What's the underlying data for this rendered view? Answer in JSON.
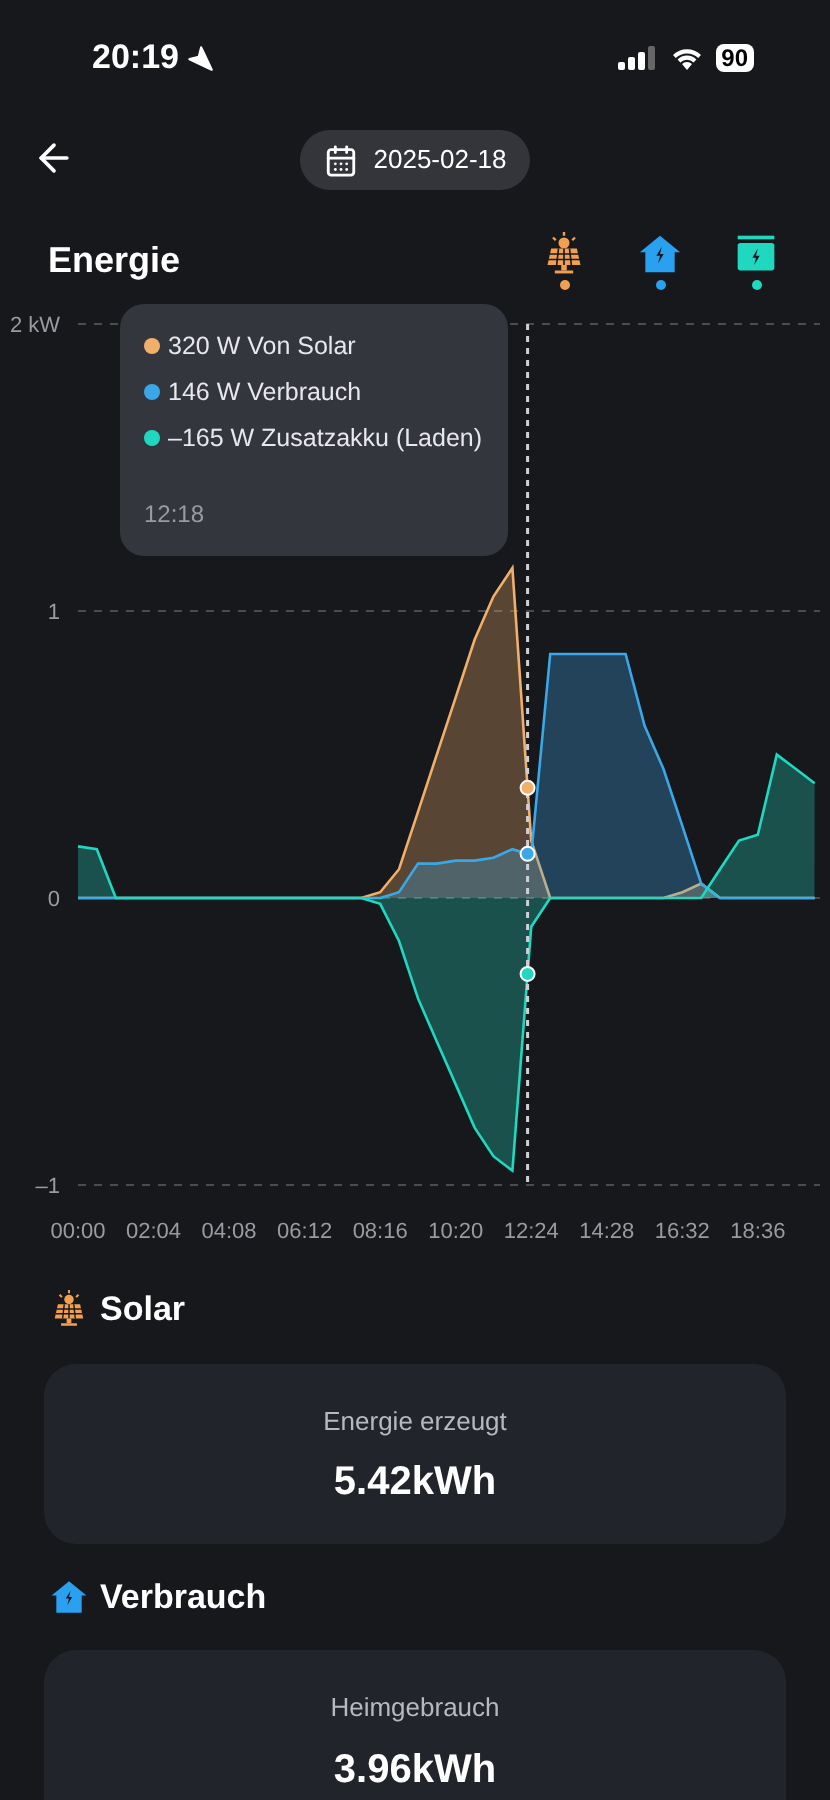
{
  "status_bar": {
    "time": "20:19",
    "battery": "90"
  },
  "header": {
    "date": "2025-02-18"
  },
  "section_title": "Energie",
  "legend": [
    {
      "kind": "solar",
      "color": "#f0a050",
      "selected": true
    },
    {
      "kind": "home",
      "color": "#2aa0f0",
      "selected": true
    },
    {
      "kind": "battery",
      "color": "#20d8c0",
      "selected": true
    }
  ],
  "chart": {
    "tooltip": {
      "time": "12:18",
      "values": [
        "320 W",
        "146 W",
        "–165 W"
      ]
    },
    "chart_data": {
      "type": "area",
      "xlim": [
        0,
        1218
      ],
      "ylim": [
        -1,
        2
      ],
      "yticks": [
        {
          "value": 2,
          "label": "2 kW"
        },
        {
          "value": 1,
          "label": "1"
        },
        {
          "value": 0,
          "label": "0"
        },
        {
          "value": -1,
          "label": "–1"
        }
      ],
      "xticks": [
        {
          "value": 0,
          "label": "00:00"
        },
        {
          "value": 124,
          "label": "02:04"
        },
        {
          "value": 248,
          "label": "04:08"
        },
        {
          "value": 372,
          "label": "06:12"
        },
        {
          "value": 496,
          "label": "08:16"
        },
        {
          "value": 620,
          "label": "10:20"
        },
        {
          "value": 744,
          "label": "12:24"
        },
        {
          "value": 868,
          "label": "14:28"
        },
        {
          "value": 992,
          "label": "16:32"
        },
        {
          "value": 1116,
          "label": "18:36"
        }
      ],
      "x": [
        0,
        31,
        62,
        93,
        124,
        155,
        186,
        217,
        248,
        279,
        310,
        341,
        372,
        403,
        434,
        465,
        496,
        527,
        558,
        589,
        620,
        651,
        682,
        713,
        744,
        775,
        806,
        837,
        868,
        899,
        930,
        961,
        992,
        1023,
        1054,
        1085,
        1116,
        1147,
        1178,
        1209
      ],
      "series": [
        {
          "name": "Von Solar",
          "color": "#f0b06a",
          "values": [
            0,
            0,
            0,
            0,
            0,
            0,
            0,
            0,
            0,
            0,
            0,
            0,
            0,
            0,
            0,
            0,
            0.02,
            0.1,
            0.3,
            0.5,
            0.7,
            0.9,
            1.05,
            1.15,
            0.2,
            0,
            0,
            0,
            0,
            0,
            0,
            0,
            0.02,
            0.05,
            0,
            0,
            0,
            0,
            0,
            0
          ]
        },
        {
          "name": "Verbrauch",
          "color": "#3aa8e8",
          "values": [
            0,
            0,
            0,
            0,
            0,
            0,
            0,
            0,
            0,
            0,
            0,
            0,
            0,
            0,
            0,
            0,
            0,
            0.02,
            0.12,
            0.12,
            0.13,
            0.13,
            0.14,
            0.17,
            0.15,
            0.85,
            0.85,
            0.85,
            0.85,
            0.85,
            0.6,
            0.45,
            0.25,
            0.05,
            0,
            0,
            0,
            0,
            0,
            0
          ]
        },
        {
          "name": "Zusatzakku (Laden)",
          "color": "#20d8c0",
          "values": [
            0.18,
            0.17,
            0,
            0,
            0,
            0,
            0,
            0,
            0,
            0,
            0,
            0,
            0,
            0,
            0,
            0,
            -0.02,
            -0.15,
            -0.35,
            -0.5,
            -0.65,
            -0.8,
            -0.9,
            -0.95,
            -0.1,
            0,
            0,
            0,
            0,
            0,
            0,
            0,
            0,
            0,
            0.1,
            0.2,
            0.22,
            0.5,
            0.45,
            0.4
          ]
        }
      ]
    }
  },
  "stats": [
    {
      "kind": "solar",
      "title": "Solar",
      "label": "Energie erzeugt",
      "value": "5.42kWh"
    },
    {
      "kind": "home",
      "title": "Verbrauch",
      "label": "Heimgebrauch",
      "value": "3.96kWh"
    }
  ]
}
